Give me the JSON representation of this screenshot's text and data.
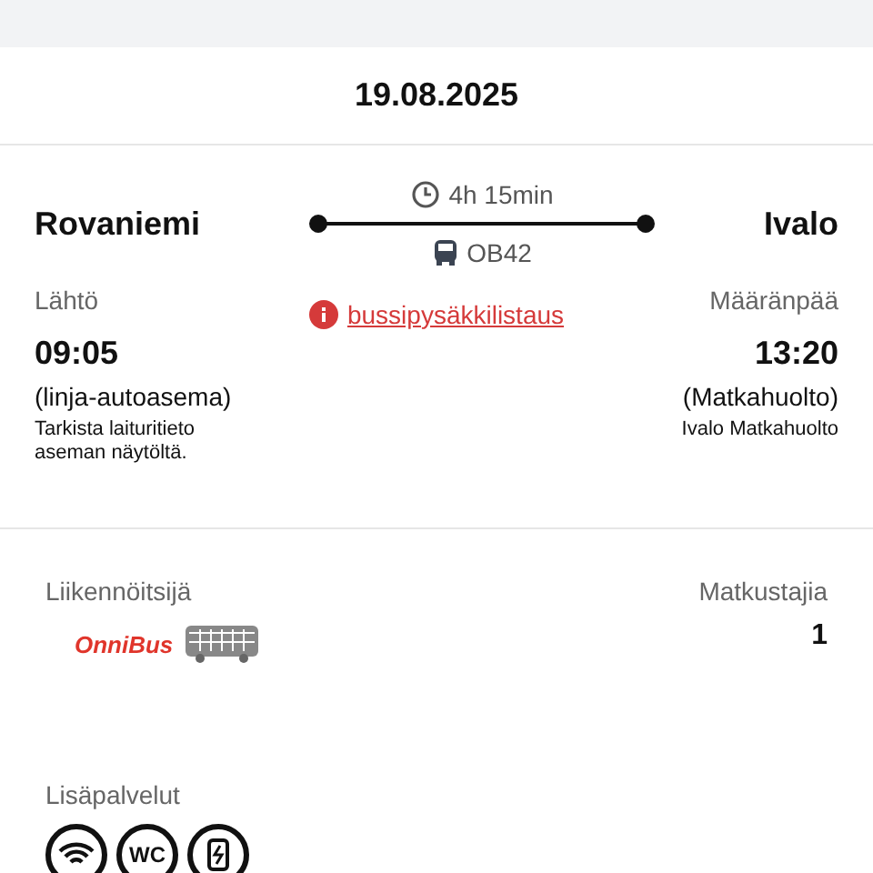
{
  "date": "19.08.2025",
  "route": {
    "from": "Rovaniemi",
    "to": "Ivalo",
    "duration": "4h 15min",
    "line": "OB42",
    "stops_link": "bussipysäkkilistaus"
  },
  "departure": {
    "label": "Lähtö",
    "time": "09:05",
    "station": "(linja-autoasema)",
    "note": "Tarkista laituritieto aseman näytöltä."
  },
  "arrival": {
    "label": "Määränpää",
    "time": "13:20",
    "station": "(Matkahuolto)",
    "note": "Ivalo Matkahuolto"
  },
  "operator": {
    "label": "Liikennöitsijä",
    "logo_text": "OnniBus"
  },
  "passengers": {
    "label": "Matkustajia",
    "count": "1"
  },
  "services": {
    "label": "Lisäpalvelut",
    "items": [
      {
        "kind": "wifi"
      },
      {
        "kind": "wc",
        "text": "WC"
      },
      {
        "kind": "charging"
      }
    ]
  }
}
